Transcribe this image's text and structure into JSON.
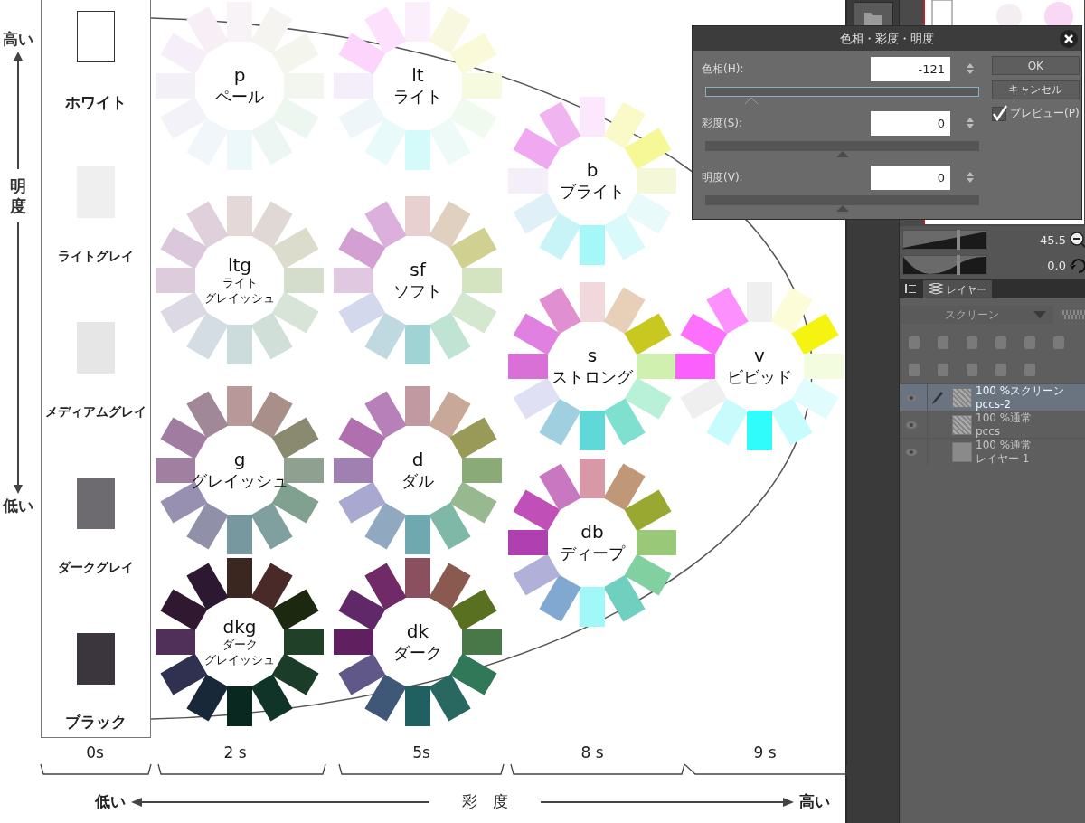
{
  "canvas": {
    "lightness_axis": {
      "top": "高い",
      "label": "明度",
      "bottom": "低い"
    },
    "achromatic": [
      {
        "name": "ホワイト",
        "color": "#ffffff"
      },
      {
        "name": "ライトグレイ",
        "color": "#efefef"
      },
      {
        "name": "メディアムグレイ",
        "color": "#e6e6e6"
      },
      {
        "name": "ダークグレイ",
        "color": "#6d6b6f"
      },
      {
        "name": "ブラック",
        "color": "#3b363d"
      }
    ],
    "wheels": [
      {
        "code": "p",
        "name_lines": [
          "ペール"
        ],
        "petals": [
          {
            "color": "#f7f3f6"
          },
          {
            "color": "#f6f4f0"
          },
          {
            "color": "#f4f6ee"
          },
          {
            "color": "#f2f6ee"
          },
          {
            "color": "#eef6f0"
          },
          {
            "color": "#eef6f4"
          },
          {
            "color": "#ecf8fa"
          },
          {
            "color": "#f0f6fa"
          },
          {
            "color": "#f2f2f8"
          },
          {
            "color": "#f4f0f8"
          },
          {
            "color": "#f6eef8"
          },
          {
            "color": "#f8eef6"
          }
        ]
      },
      {
        "code": "lt",
        "name_lines": [
          "ライト"
        ],
        "petals": [
          {
            "color": "#fbeffb"
          },
          {
            "color": "#f8f8e0"
          },
          {
            "color": "#fafad8"
          },
          {
            "color": "#f6fade"
          },
          {
            "color": "#f0faee"
          },
          {
            "color": "#eefaf8"
          },
          {
            "color": "#d4fafa"
          },
          {
            "color": "#e8fafa"
          },
          {
            "color": "#eef6fa"
          },
          {
            "color": "#f4eefa"
          },
          {
            "color": "#fcd4fc"
          },
          {
            "color": "#fce0fc"
          }
        ]
      },
      {
        "code": "b",
        "name_lines": [
          "ブライト"
        ],
        "petals": [
          {
            "color": "#fce8fc"
          },
          {
            "color": "#fafac8"
          },
          {
            "color": "#f6f898"
          },
          {
            "color": "#f4f8d8"
          },
          {
            "color": "#e8fafa"
          },
          {
            "color": "#d8fafa"
          },
          {
            "color": "#a4f8f8"
          },
          {
            "color": "#c8f4f8"
          },
          {
            "color": "#e0f0f8"
          },
          {
            "color": "#f4eef8"
          },
          {
            "color": "#f0a8f0"
          },
          {
            "color": "#f0b4f0"
          }
        ]
      },
      {
        "code": "ltg",
        "name_lines": [
          "ライト",
          "グレイッシュ"
        ],
        "petals": [
          {
            "color": "#e4d8d8"
          },
          {
            "color": "#e0d8d4"
          },
          {
            "color": "#dcdccc"
          },
          {
            "color": "#d4dccc"
          },
          {
            "color": "#d8e4d8"
          },
          {
            "color": "#d0e0d8"
          },
          {
            "color": "#ccdcdc"
          },
          {
            "color": "#d4dce4"
          },
          {
            "color": "#dcd8e4"
          },
          {
            "color": "#dcccdc"
          },
          {
            "color": "#dcc8dc"
          },
          {
            "color": "#e0d0dc"
          }
        ]
      },
      {
        "code": "sf",
        "name_lines": [
          "ソフト"
        ],
        "petals": [
          {
            "color": "#e8d0d0"
          },
          {
            "color": "#e0d0c0"
          },
          {
            "color": "#d0d090"
          },
          {
            "color": "#d4e4c0"
          },
          {
            "color": "#d4e8d0"
          },
          {
            "color": "#c0e4d4"
          },
          {
            "color": "#a0d4d4"
          },
          {
            "color": "#c0d8e0"
          },
          {
            "color": "#d4d8ec"
          },
          {
            "color": "#e0c8e0"
          },
          {
            "color": "#d4a0d4"
          },
          {
            "color": "#dcb0dc"
          }
        ]
      },
      {
        "code": "s",
        "name_lines": [
          "ストロング"
        ],
        "petals": [
          {
            "color": "#f0d8dc"
          },
          {
            "color": "#e8d0b8"
          },
          {
            "color": "#c8c820"
          },
          {
            "color": "#d0f0b0"
          },
          {
            "color": "#b8f0d8"
          },
          {
            "color": "#80e0d0"
          },
          {
            "color": "#60d8d8"
          },
          {
            "color": "#a0d0e0"
          },
          {
            "color": "#e0e0f4"
          },
          {
            "color": "#d870d8"
          },
          {
            "color": "#e080e0"
          },
          {
            "color": "#e090d0"
          }
        ]
      },
      {
        "code": "v",
        "name_lines": [
          "ビビッド"
        ],
        "petals": [
          {
            "color": "#efefef"
          },
          {
            "color": "#fcfcd8"
          },
          {
            "color": "#f4f410"
          },
          {
            "color": "#f4fce0"
          },
          {
            "color": "#e0fcfc"
          },
          {
            "color": "#c8fcfc"
          },
          {
            "color": "#30fcfc"
          },
          {
            "color": "#c8fcfc"
          },
          {
            "color": "#efefef"
          },
          {
            "color": "#fc60fc"
          },
          {
            "color": "#fc70fc"
          },
          {
            "color": "#fc90fc"
          }
        ]
      },
      {
        "code": "g",
        "name_lines": [
          "グレイッシュ"
        ],
        "petals": [
          {
            "color": "#b89898"
          },
          {
            "color": "#a89088"
          },
          {
            "color": "#8a8a70"
          },
          {
            "color": "#90a090"
          },
          {
            "color": "#80a090"
          },
          {
            "color": "#80a0a0"
          },
          {
            "color": "#7898a0"
          },
          {
            "color": "#9090a8"
          },
          {
            "color": "#9890b0"
          },
          {
            "color": "#a080a0"
          },
          {
            "color": "#a07ca0"
          },
          {
            "color": "#a08898"
          }
        ]
      },
      {
        "code": "d",
        "name_lines": [
          "ダル"
        ],
        "petals": [
          {
            "color": "#c09aa0"
          },
          {
            "color": "#c8a898"
          },
          {
            "color": "#9a9a58"
          },
          {
            "color": "#8aaa78"
          },
          {
            "color": "#98b890"
          },
          {
            "color": "#80b8a8"
          },
          {
            "color": "#70a8b0"
          },
          {
            "color": "#90a8c0"
          },
          {
            "color": "#a8a8d0"
          },
          {
            "color": "#a080b0"
          },
          {
            "color": "#b070b0"
          },
          {
            "color": "#b880b8"
          }
        ]
      },
      {
        "code": "db",
        "name_lines": [
          "ディープ"
        ],
        "petals": [
          {
            "color": "#d898a8"
          },
          {
            "color": "#c09878"
          },
          {
            "color": "#98a830"
          },
          {
            "color": "#98c878"
          },
          {
            "color": "#80d0a0"
          },
          {
            "color": "#70d0c0"
          },
          {
            "color": "#a0f8f8"
          },
          {
            "color": "#80a8d0"
          },
          {
            "color": "#b0b0d8"
          },
          {
            "color": "#b040b0"
          },
          {
            "color": "#c050b8"
          },
          {
            "color": "#c878c0"
          }
        ]
      },
      {
        "code": "dkg",
        "name_lines": [
          "ダーク",
          "グレイッシュ"
        ],
        "petals": [
          {
            "color": "#3a2820"
          },
          {
            "color": "#4a2a28"
          },
          {
            "color": "#1c2810"
          },
          {
            "color": "#204028"
          },
          {
            "color": "#1a3c28"
          },
          {
            "color": "#103428"
          },
          {
            "color": "#082820"
          },
          {
            "color": "#182838"
          },
          {
            "color": "#303050"
          },
          {
            "color": "#503058"
          },
          {
            "color": "#301830"
          },
          {
            "color": "#2c1830"
          }
        ]
      },
      {
        "code": "dk",
        "name_lines": [
          "ダーク"
        ],
        "petals": [
          {
            "color": "#8a5060"
          },
          {
            "color": "#8a5a50"
          },
          {
            "color": "#587020"
          },
          {
            "color": "#487848"
          },
          {
            "color": "#307858"
          },
          {
            "color": "#286860"
          },
          {
            "color": "#206060"
          },
          {
            "color": "#405878"
          },
          {
            "color": "#605888"
          },
          {
            "color": "#602060"
          },
          {
            "color": "#602868"
          },
          {
            "color": "#702a68"
          }
        ]
      }
    ],
    "chroma_groups": [
      "0s",
      "2 s",
      "5s",
      "8 s",
      "9 s"
    ],
    "chroma_axis": {
      "left": "低い",
      "label": "彩　度",
      "right": "高い"
    }
  },
  "dialog": {
    "title": "色相・彩度・明度",
    "fields": [
      {
        "label": "色相(H):",
        "value": "-121",
        "level": 0.165,
        "selected": true
      },
      {
        "label": "彩度(S):",
        "value": "0",
        "level": 0.5,
        "selected": false
      },
      {
        "label": "明度(V):",
        "value": "0",
        "level": 0.5,
        "selected": false
      }
    ],
    "buttons": [
      "OK",
      "キャンセル"
    ],
    "preview": {
      "label": "プレビュー(P)",
      "checked": true
    }
  },
  "view_controls": [
    {
      "value": "45.5",
      "kind": "zoom",
      "level": 0.66
    },
    {
      "value": "0.0",
      "kind": "rotate",
      "level": 0.66
    }
  ],
  "layer_panel": {
    "tab": "レイヤー",
    "blend_mode": "スクリーン",
    "layers": [
      {
        "mode": "100 %スクリーン",
        "name": "pccs-2",
        "selected": true,
        "kind": "pattern"
      },
      {
        "mode": "100 %通常",
        "name": "pccs",
        "selected": false,
        "kind": "pattern"
      },
      {
        "mode": "100 %通常",
        "name": "レイヤー 1",
        "selected": false,
        "kind": "plain"
      }
    ]
  }
}
